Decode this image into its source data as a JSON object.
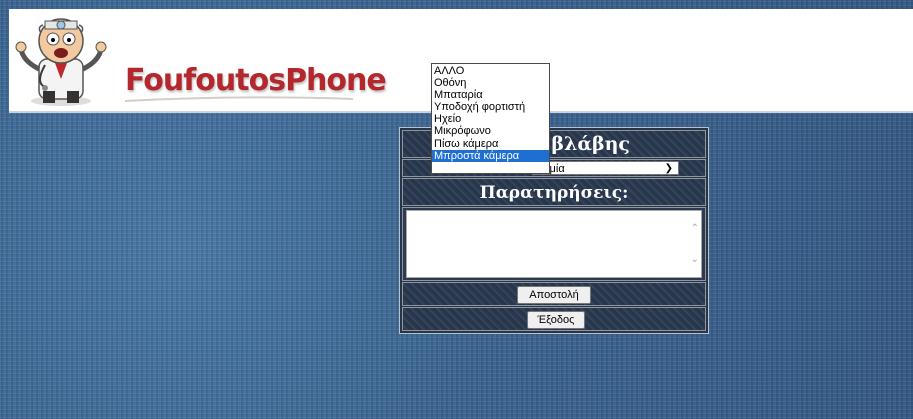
{
  "brand": {
    "name": "FoufoutosPhone",
    "color": "#b3272d"
  },
  "form": {
    "title_partial": "η βλάβης",
    "damage_select": {
      "selected_value": "Καμία",
      "options": [
        "ΑΛΛΟ",
        "Οθόνη",
        "Μπαταρία",
        "Υποδοχή φορτιστή",
        "Ηχείο",
        "Μικρόφωνο",
        "Πίσω κάμερα",
        "Μπροστά κάμερα"
      ],
      "highlighted_option": "Μπροστά κάμερα"
    },
    "notes_label": "Παρατηρήσεις:",
    "notes_value": "",
    "submit_label": "Αποστολή",
    "exit_label": "Έξοδος"
  },
  "colors": {
    "page_background": "#3f6a97",
    "panel_background": "#2a3447",
    "highlight": "#1e6fd1"
  }
}
